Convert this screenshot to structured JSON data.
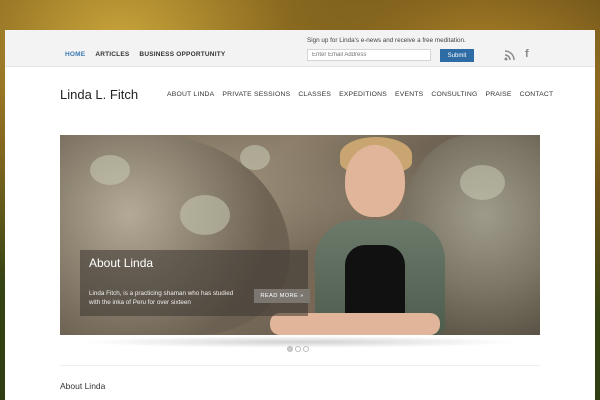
{
  "topbar": {
    "nav": [
      "HOME",
      "ARTICLES",
      "BUSINESS OPPORTUNITY"
    ],
    "signup_text": "Sign up for Linda's e-news and receive a free meditation.",
    "email_placeholder": "Enter Email Address",
    "submit_label": "Submit",
    "icons": [
      "rss-icon",
      "facebook-icon"
    ]
  },
  "header": {
    "logo": "Linda L. Fitch",
    "nav": [
      "ABOUT LINDA",
      "PRIVATE SESSIONS",
      "CLASSES",
      "EXPEDITIONS",
      "EVENTS",
      "CONSULTING",
      "PRAISE",
      "CONTACT"
    ]
  },
  "slider": {
    "caption_title": "About Linda",
    "caption_text": "Linda Fitch, is a practicing shaman who has studied with the inka of Peru for over sixteen",
    "read_more": "READ MORE »",
    "dots": 3,
    "active_dot": 0
  },
  "content": {
    "heading": "About Linda"
  },
  "colors": {
    "accent": "#3b79b3",
    "submit_bg": "#2e6ca5"
  }
}
